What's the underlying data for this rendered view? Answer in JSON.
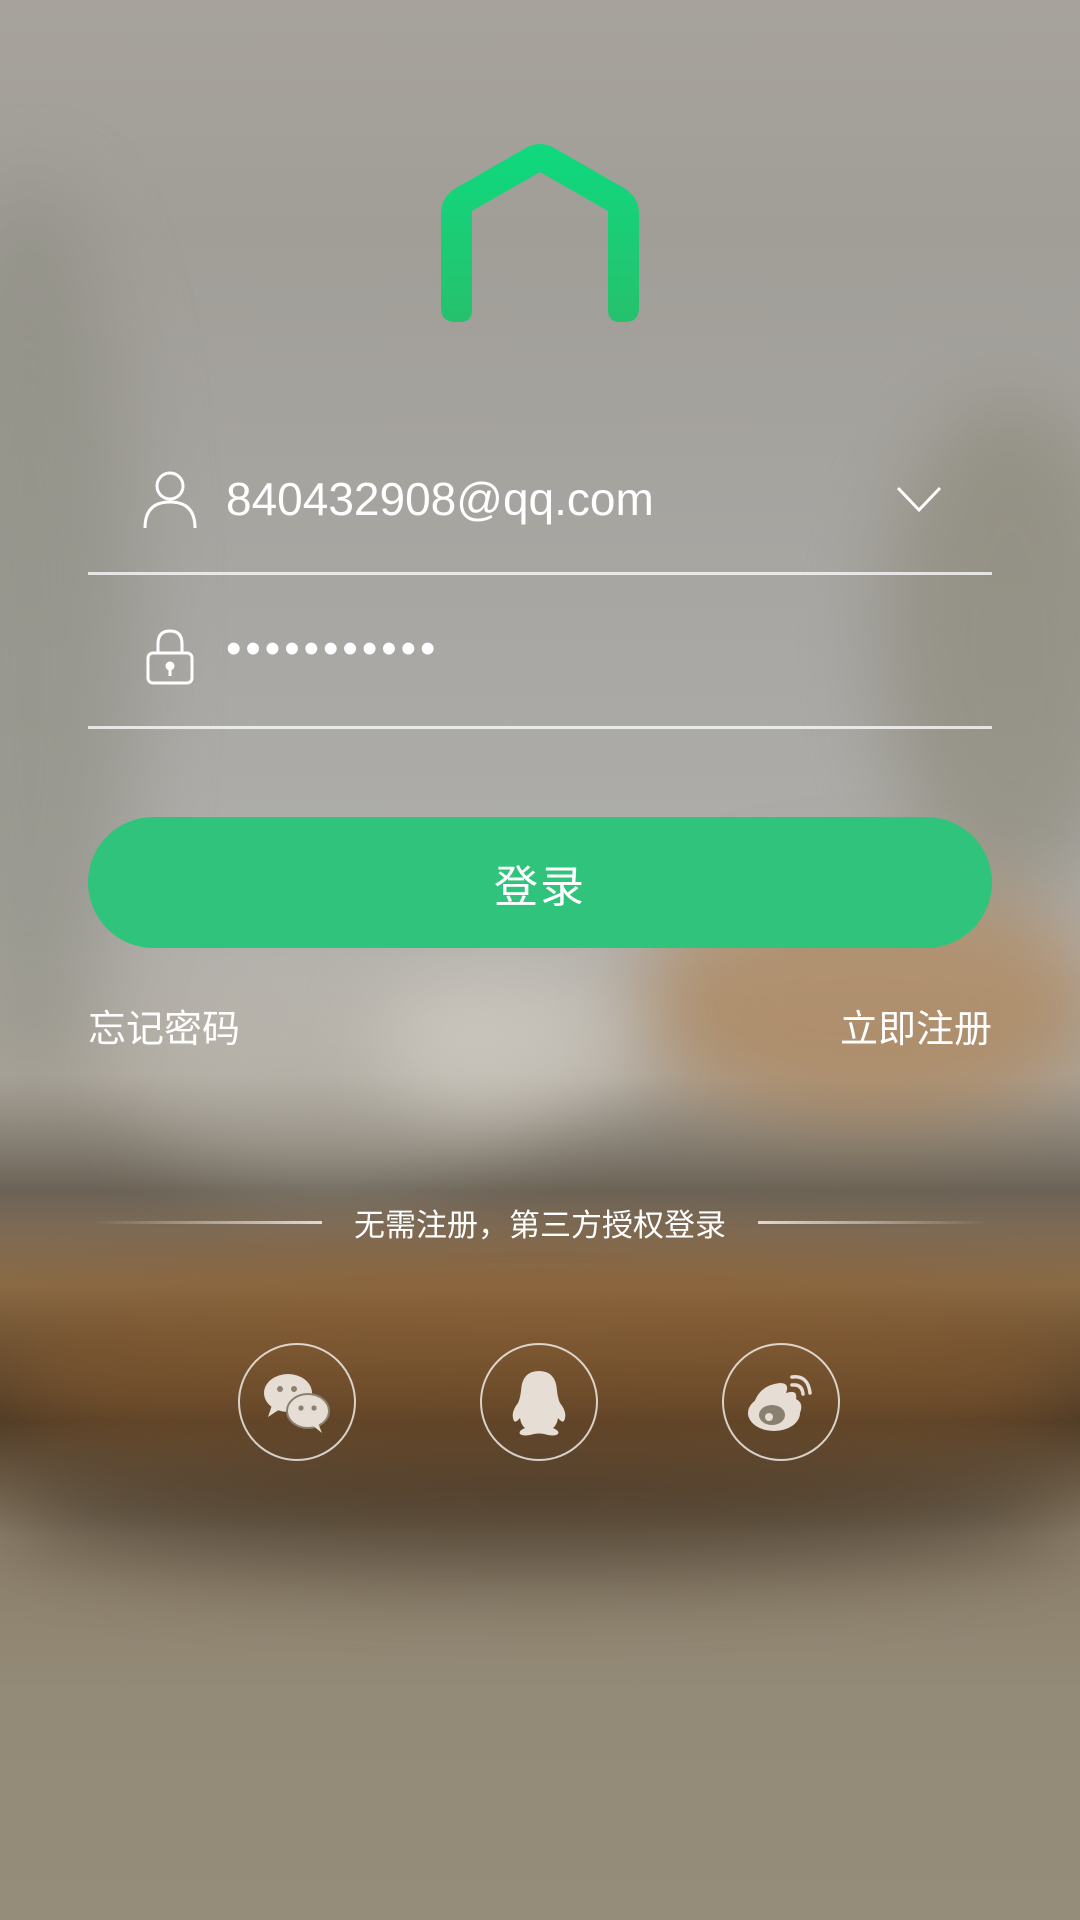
{
  "login": {
    "account_value": "840432908@qq.com",
    "password_value": "•••••••••••",
    "login_label": "登录",
    "forgot_password": "忘记密码",
    "register_now": "立即注册"
  },
  "third_party": {
    "divider_text": "无需注册，第三方授权登录",
    "providers": [
      {
        "name": "wechat-icon"
      },
      {
        "name": "qq-icon"
      },
      {
        "name": "weibo-icon"
      }
    ]
  },
  "colors": {
    "brand_green": "#30c37b",
    "logo_green_top": "#0fd97e",
    "logo_green_bottom": "#26c16d"
  }
}
